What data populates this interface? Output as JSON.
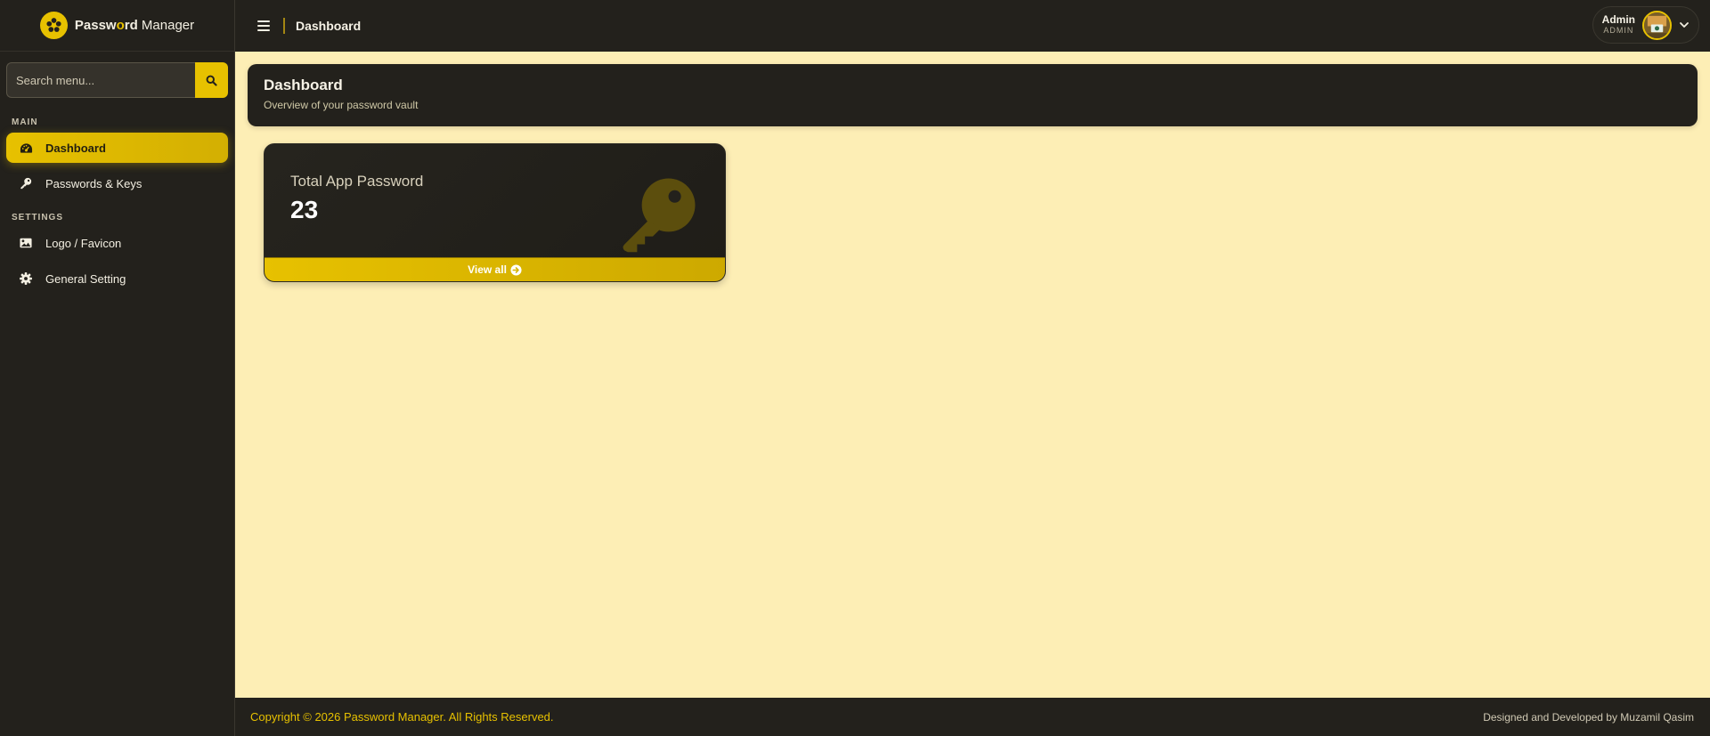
{
  "brand": {
    "part1": "Passw",
    "part2": "o",
    "part3": "rd",
    "part4": "Manager"
  },
  "sidebar": {
    "search_placeholder": "Search menu...",
    "sections": [
      {
        "title": "MAIN"
      },
      {
        "title": "SETTINGS"
      }
    ],
    "items": [
      {
        "label": "Dashboard",
        "icon": "gauge-icon",
        "active": true
      },
      {
        "label": "Passwords & Keys",
        "icon": "key-icon"
      },
      {
        "label": "Logo / Favicon",
        "icon": "image-icon"
      },
      {
        "label": "General Setting",
        "icon": "gear-icon"
      }
    ]
  },
  "topbar": {
    "title": "Dashboard",
    "user": {
      "name": "Admin",
      "role": "ADMIN"
    }
  },
  "page_header": {
    "title": "Dashboard",
    "subtitle": "Overview of your password vault"
  },
  "stat_card": {
    "label": "Total App Password",
    "value": "23",
    "link_label": "View all"
  },
  "footer": {
    "copyright": "Copyright © 2026 Password Manager. All Rights Reserved.",
    "credit": "Designed and Developed by Muzamil Qasim"
  },
  "colors": {
    "accent": "#e7c100",
    "dark": "#23211c",
    "background": "#fdeeb5"
  }
}
